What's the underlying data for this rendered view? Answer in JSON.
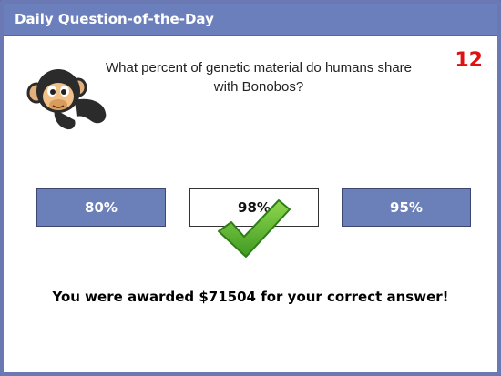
{
  "dialog": {
    "title": "Daily Question-of-the-Day",
    "counter": "12",
    "question": "What percent of genetic material do humans share with Bonobos?",
    "answers": [
      {
        "label": "80%",
        "state": "wrong"
      },
      {
        "label": "98%",
        "state": "correct"
      },
      {
        "label": "95%",
        "state": "wrong"
      }
    ],
    "result": "You were awarded $71504 for your correct answer!",
    "icons": {
      "mascot": "chimpanzee-icon",
      "check": "checkmark-icon"
    },
    "colors": {
      "titlebar": "#6b7fbc",
      "answer_button": "#6b7fb9",
      "counter": "#e01010",
      "check": "#4caf32"
    }
  }
}
